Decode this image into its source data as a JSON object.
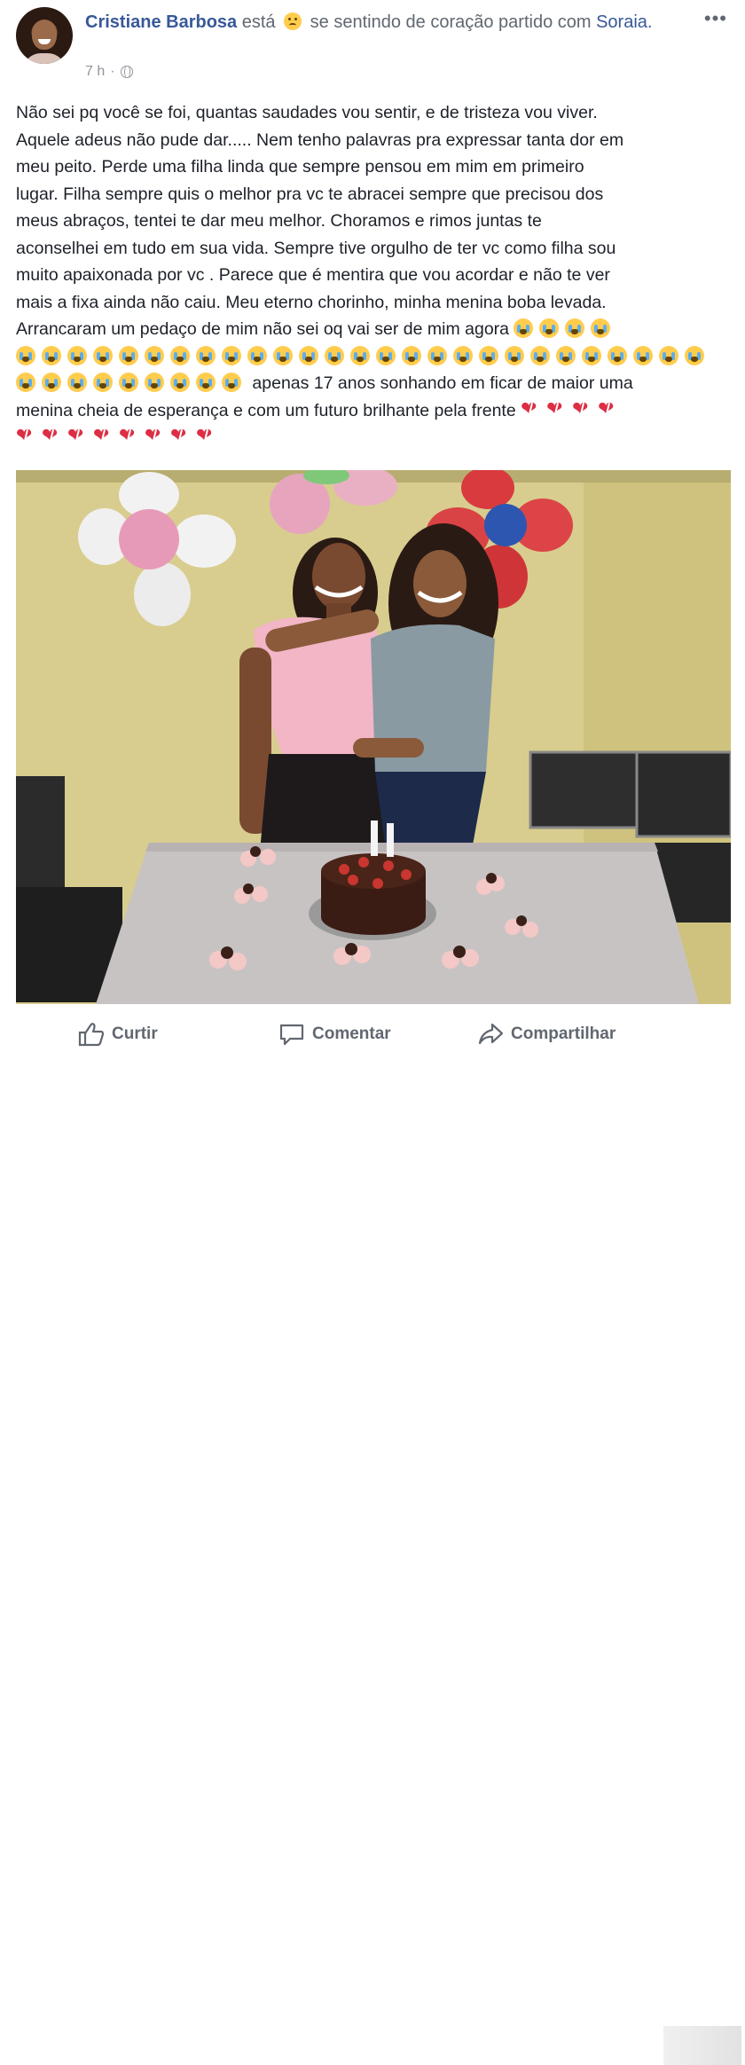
{
  "post": {
    "author": "Cristiane Barbosa",
    "verb": "está",
    "feeling": "se sentindo de coração partido com",
    "tagged": "Soraia.",
    "time": "7 h",
    "separator": "·",
    "more_icon": "•••",
    "text_lines": [
      "Não sei pq você se foi, quantas saudades vou sentir, e de tristeza vou viver.",
      "Aquele adeus não pude dar..... Nem tenho palavras pra expressar tanta dor em",
      "meu peito. Perde uma filha linda que sempre pensou em mim em primeiro",
      "lugar. Filha sempre quis o melhor pra vc te abracei sempre que precisou dos",
      "meus abraços, tentei te dar meu melhor. Choramos e rimos juntas te",
      "aconselhei em tudo em sua vida. Sempre tive orgulho de ter vc como filha sou",
      "muito apaixonada por vc . Parece que é mentira que vou acordar e não te ver",
      "mais a fixa ainda não caiu. Meu eterno chorinho, minha menina boba levada.",
      "Arrancaram um pedaço de mim não sei oq vai ser de mim agora"
    ],
    "text_after_emoji": "apenas 17 anos sonhando em ficar de maior uma",
    "text_line_last": "menina cheia de esperança e com um futuro brilhante pela frente",
    "emoji_icons": [
      "loudly-crying-face-icon",
      "broken-heart-icon",
      "sad-face-icon"
    ]
  },
  "actions": {
    "like": "Curtir",
    "comment": "Comentar",
    "share": "Compartilhar"
  },
  "colors": {
    "link": "#385898",
    "meta": "#90949c",
    "text": "#1d2129",
    "action": "#616770"
  }
}
